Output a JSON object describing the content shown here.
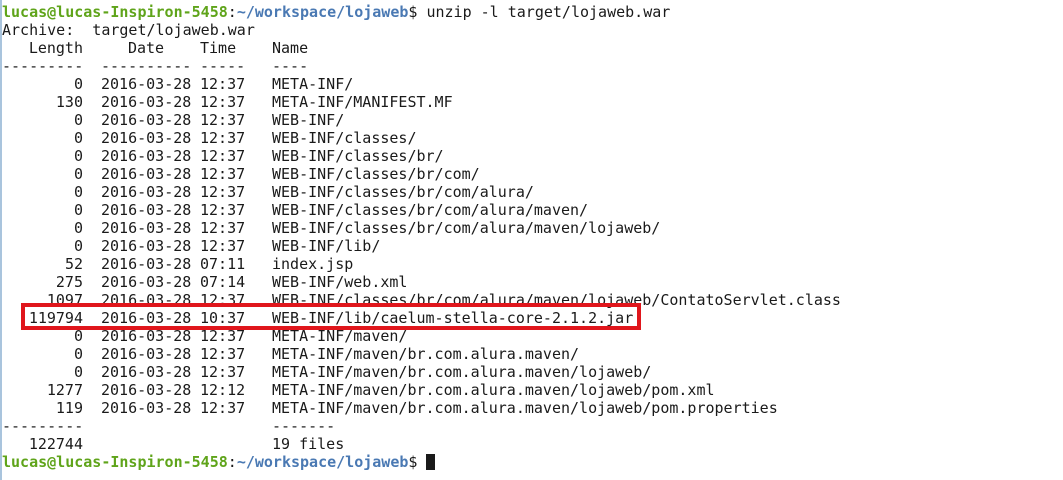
{
  "prompt": {
    "user_host": "lucas@lucas-Inspiron-5458",
    "separator": ":",
    "path": "~/workspace/lojaweb",
    "symbol": "$ "
  },
  "command": "unzip -l target/lojaweb.war",
  "archive_line": "Archive:  target/lojaweb.war",
  "headers": {
    "length": "Length",
    "date": "Date",
    "time": "Time",
    "name": "Name"
  },
  "header_rule": {
    "length": "---------",
    "date": "----------",
    "time": "-----",
    "name": "----"
  },
  "entries": [
    {
      "length": "0",
      "date": "2016-03-28",
      "time": "12:37",
      "name": "META-INF/"
    },
    {
      "length": "130",
      "date": "2016-03-28",
      "time": "12:37",
      "name": "META-INF/MANIFEST.MF"
    },
    {
      "length": "0",
      "date": "2016-03-28",
      "time": "12:37",
      "name": "WEB-INF/"
    },
    {
      "length": "0",
      "date": "2016-03-28",
      "time": "12:37",
      "name": "WEB-INF/classes/"
    },
    {
      "length": "0",
      "date": "2016-03-28",
      "time": "12:37",
      "name": "WEB-INF/classes/br/"
    },
    {
      "length": "0",
      "date": "2016-03-28",
      "time": "12:37",
      "name": "WEB-INF/classes/br/com/"
    },
    {
      "length": "0",
      "date": "2016-03-28",
      "time": "12:37",
      "name": "WEB-INF/classes/br/com/alura/"
    },
    {
      "length": "0",
      "date": "2016-03-28",
      "time": "12:37",
      "name": "WEB-INF/classes/br/com/alura/maven/"
    },
    {
      "length": "0",
      "date": "2016-03-28",
      "time": "12:37",
      "name": "WEB-INF/classes/br/com/alura/maven/lojaweb/"
    },
    {
      "length": "0",
      "date": "2016-03-28",
      "time": "12:37",
      "name": "WEB-INF/lib/"
    },
    {
      "length": "52",
      "date": "2016-03-28",
      "time": "07:11",
      "name": "index.jsp"
    },
    {
      "length": "275",
      "date": "2016-03-28",
      "time": "07:14",
      "name": "WEB-INF/web.xml"
    },
    {
      "length": "1097",
      "date": "2016-03-28",
      "time": "12:37",
      "name": "WEB-INF/classes/br/com/alura/maven/lojaweb/ContatoServlet.class"
    },
    {
      "length": "119794",
      "date": "2016-03-28",
      "time": "10:37",
      "name": "WEB-INF/lib/caelum-stella-core-2.1.2.jar"
    },
    {
      "length": "0",
      "date": "2016-03-28",
      "time": "12:37",
      "name": "META-INF/maven/"
    },
    {
      "length": "0",
      "date": "2016-03-28",
      "time": "12:37",
      "name": "META-INF/maven/br.com.alura.maven/"
    },
    {
      "length": "0",
      "date": "2016-03-28",
      "time": "12:37",
      "name": "META-INF/maven/br.com.alura.maven/lojaweb/"
    },
    {
      "length": "1277",
      "date": "2016-03-28",
      "time": "12:12",
      "name": "META-INF/maven/br.com.alura.maven/lojaweb/pom.xml"
    },
    {
      "length": "119",
      "date": "2016-03-28",
      "time": "12:37",
      "name": "META-INF/maven/br.com.alura.maven/lojaweb/pom.properties"
    }
  ],
  "footer_rule": {
    "length": "---------",
    "name": "-------"
  },
  "totals": {
    "length": "122744",
    "name": "19 files"
  },
  "highlighted_entry": "WEB-INF/lib/caelum-stella-core-2.1.2.jar",
  "colors": {
    "prompt_user_host": "#5fa41a",
    "prompt_path": "#4a79b3",
    "highlight_box": "#e0161c",
    "text": "#1a1a1a",
    "background": "#ffffff"
  }
}
